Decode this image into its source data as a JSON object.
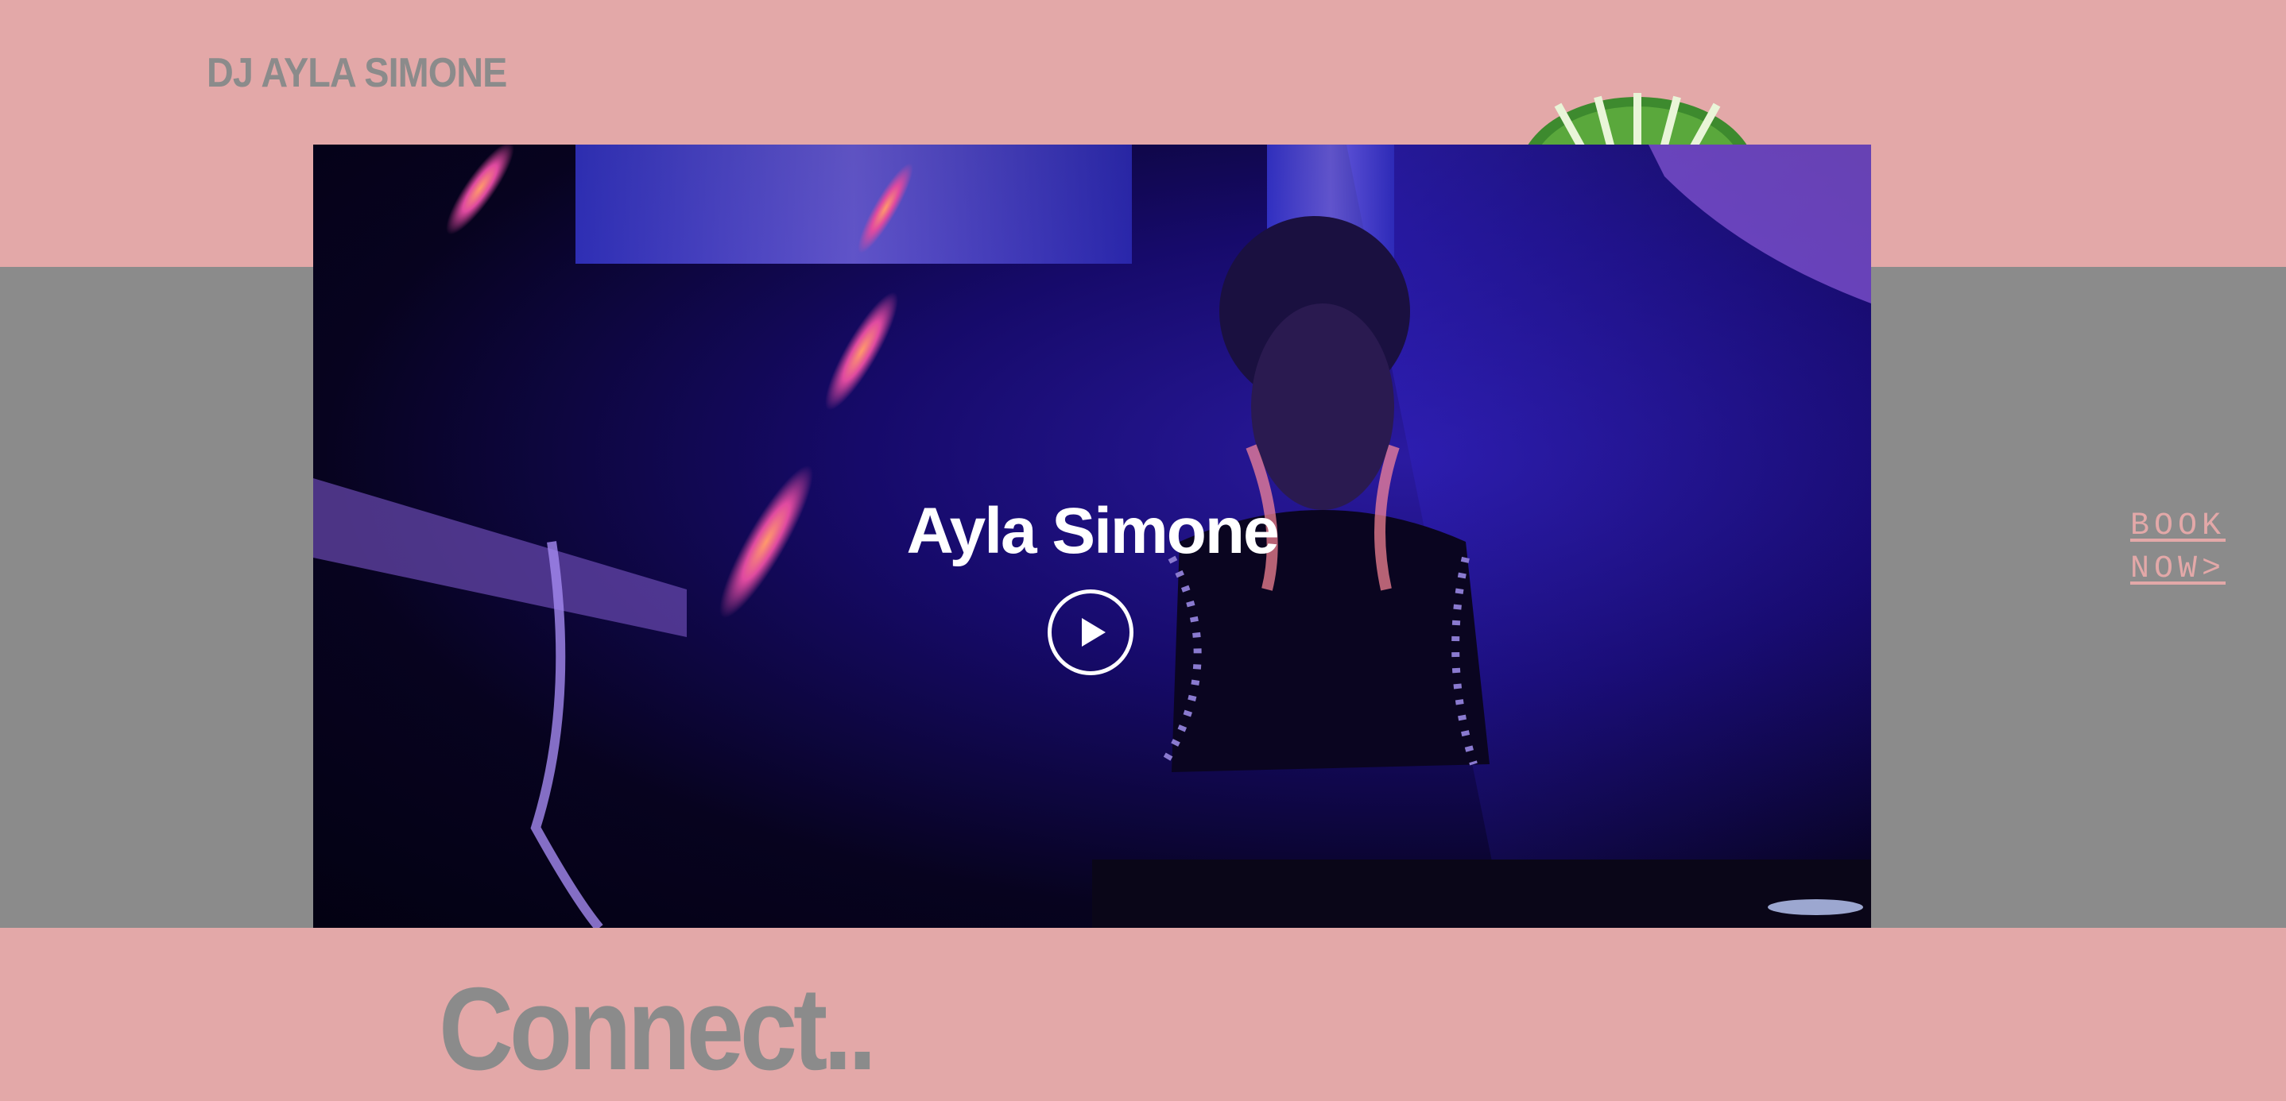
{
  "site": {
    "logo_text": "DJ AYLA SIMONE"
  },
  "hero": {
    "video_title": "Ayla Simone",
    "play_icon": "play-icon"
  },
  "cta": {
    "book_line1": "BOOK",
    "book_line2": "NOW>"
  },
  "section": {
    "connect_heading": "Connect.."
  },
  "colors": {
    "pink_background": "#e3a8a8",
    "gray_band": "#8b8b8b",
    "title_text": "#ffffff",
    "video_tint": "#160a6a"
  }
}
